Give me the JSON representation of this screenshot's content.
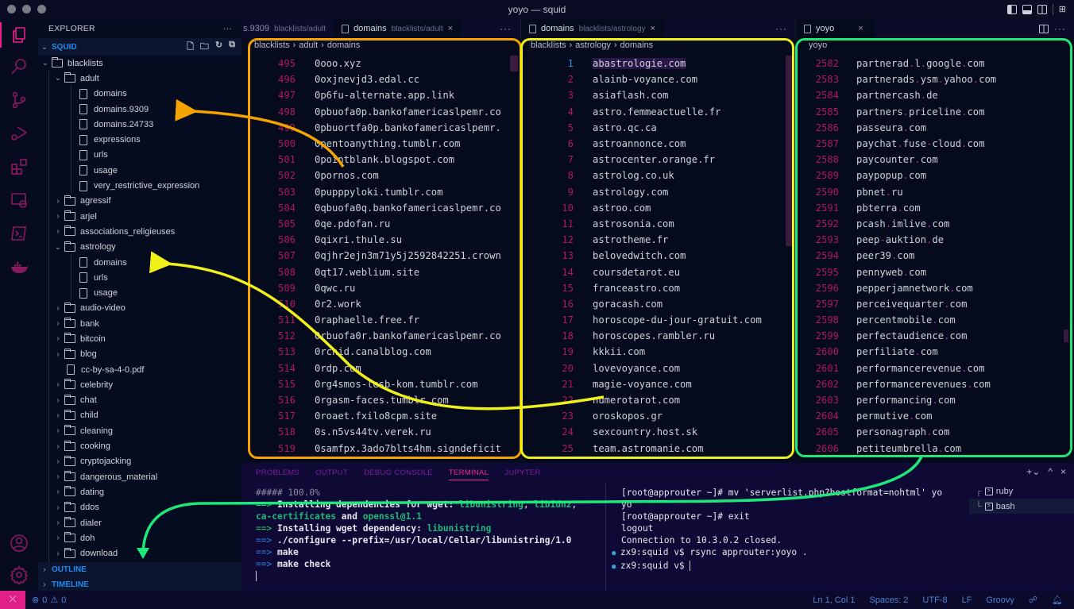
{
  "window": {
    "title": "yoyo — squid"
  },
  "activity_bar": {
    "items": [
      "explorer",
      "search",
      "source-control",
      "run-debug",
      "extensions",
      "remote-explorer",
      "terminal",
      "docker",
      "accounts",
      "settings"
    ]
  },
  "sidebar": {
    "header": "EXPLORER",
    "more": "···",
    "section": "SQUID",
    "tree": [
      {
        "label": "blacklists",
        "type": "folder",
        "depth": 0,
        "open": true
      },
      {
        "label": "adult",
        "type": "folder",
        "depth": 1,
        "open": true
      },
      {
        "label": "domains",
        "type": "file",
        "depth": 2
      },
      {
        "label": "domains.9309",
        "type": "file",
        "depth": 2
      },
      {
        "label": "domains.24733",
        "type": "file",
        "depth": 2
      },
      {
        "label": "expressions",
        "type": "file",
        "depth": 2
      },
      {
        "label": "urls",
        "type": "file",
        "depth": 2
      },
      {
        "label": "usage",
        "type": "file",
        "depth": 2
      },
      {
        "label": "very_restrictive_expression",
        "type": "file",
        "depth": 2
      },
      {
        "label": "agressif",
        "type": "folder",
        "depth": 1,
        "open": false
      },
      {
        "label": "arjel",
        "type": "folder",
        "depth": 1,
        "open": false
      },
      {
        "label": "associations_religieuses",
        "type": "folder",
        "depth": 1,
        "open": false
      },
      {
        "label": "astrology",
        "type": "folder",
        "depth": 1,
        "open": true
      },
      {
        "label": "domains",
        "type": "file",
        "depth": 2
      },
      {
        "label": "urls",
        "type": "file",
        "depth": 2
      },
      {
        "label": "usage",
        "type": "file",
        "depth": 2
      },
      {
        "label": "audio-video",
        "type": "folder",
        "depth": 1,
        "open": false
      },
      {
        "label": "bank",
        "type": "folder",
        "depth": 1,
        "open": false
      },
      {
        "label": "bitcoin",
        "type": "folder",
        "depth": 1,
        "open": false
      },
      {
        "label": "blog",
        "type": "folder",
        "depth": 1,
        "open": false
      },
      {
        "label": "cc-by-sa-4-0.pdf",
        "type": "file",
        "depth": 1
      },
      {
        "label": "celebrity",
        "type": "folder",
        "depth": 1,
        "open": false
      },
      {
        "label": "chat",
        "type": "folder",
        "depth": 1,
        "open": false
      },
      {
        "label": "child",
        "type": "folder",
        "depth": 1,
        "open": false
      },
      {
        "label": "cleaning",
        "type": "folder",
        "depth": 1,
        "open": false
      },
      {
        "label": "cooking",
        "type": "folder",
        "depth": 1,
        "open": false
      },
      {
        "label": "cryptojacking",
        "type": "folder",
        "depth": 1,
        "open": false
      },
      {
        "label": "dangerous_material",
        "type": "folder",
        "depth": 1,
        "open": false
      },
      {
        "label": "dating",
        "type": "folder",
        "depth": 1,
        "open": false
      },
      {
        "label": "ddos",
        "type": "folder",
        "depth": 1,
        "open": false
      },
      {
        "label": "dialer",
        "type": "folder",
        "depth": 1,
        "open": false
      },
      {
        "label": "doh",
        "type": "folder",
        "depth": 1,
        "open": false
      },
      {
        "label": "download",
        "type": "folder",
        "depth": 1,
        "open": false
      }
    ],
    "outline": "OUTLINE",
    "timeline": "TIMELINE"
  },
  "editors": [
    {
      "tabs": [
        {
          "name": "s.9309",
          "desc": "blacklists/adult",
          "active": false
        },
        {
          "name": "domains",
          "desc": "blacklists/adult",
          "active": true
        }
      ],
      "breadcrumb": [
        "blacklists",
        "adult",
        "domains"
      ],
      "start": 495,
      "lines": [
        "0ooo.xyz",
        "0oxjnevjd3.edal.cc",
        "0p6fu-alternate.app.link",
        "0pbuofa0p.bankofamericaslpemr.co",
        "0pbuortfa0p.bankofamericaslpemr.",
        "0pentoanything.tumblr.com",
        "0pointblank.blogspot.com",
        "0pornos.com",
        "0pupppyloki.tumblr.com",
        "0qbuofa0q.bankofamericaslpemr.co",
        "0qe.pdofan.ru",
        "0qixri.thule.su",
        "0qjhr2ejn3m71y5j2592842251.crown",
        "0qt17.weblium.site",
        "0qwc.ru",
        "0r2.work",
        "0raphaelle.free.fr",
        "0rbuofa0r.bankofamericaslpemr.co",
        "0rchid.canalblog.com",
        "0rdp.com",
        "0rg4smos-lesb-kom.tumblr.com",
        "0rgasm-faces.tumblr.com",
        "0roaet.fxilo8cpm.site",
        "0s.n5vs44tv.verek.ru",
        "0samfpx.3ado7blts4hm.signdeficit"
      ]
    },
    {
      "tabs": [
        {
          "name": "domains",
          "desc": "blacklists/astrology",
          "active": true
        }
      ],
      "breadcrumb": [
        "blacklists",
        "astrology",
        "domains"
      ],
      "start": 1,
      "current_line": 1,
      "lines": [
        "abastrologie.com",
        "alainb-voyance.com",
        "asiaflash.com",
        "astro.femmeactuelle.fr",
        "astro.qc.ca",
        "astroannonce.com",
        "astrocenter.orange.fr",
        "astrolog.co.uk",
        "astrology.com",
        "astroo.com",
        "astrosonia.com",
        "astrotheme.fr",
        "belovedwitch.com",
        "coursdetarot.eu",
        "franceastro.com",
        "goracash.com",
        "horoscope-du-jour-gratuit.com",
        "horoscopes.rambler.ru",
        "kkkii.com",
        "lovevoyance.com",
        "magie-voyance.com",
        "numerotarot.com",
        "oroskopos.gr",
        "sexcountry.host.sk",
        "team.astromanie.com"
      ]
    },
    {
      "tabs": [
        {
          "name": "yoyo",
          "desc": "",
          "active": true
        }
      ],
      "breadcrumb": [
        "yoyo"
      ],
      "start": 2582,
      "lines": [
        "partnerad.l.google.com",
        "partnerads.ysm.yahoo.com",
        "partnercash.de",
        "partners.priceline.com",
        "passeura.com",
        "paychat.fuse-cloud.com",
        "paycounter.com",
        "paypopup.com",
        "pbnet.ru",
        "pbterra.com",
        "pcash.imlive.com",
        "peep-auktion.de",
        "peer39.com",
        "pennyweb.com",
        "pepperjamnetwork.com",
        "perceivequarter.com",
        "percentmobile.com",
        "perfectaudience.com",
        "perfiliate.com",
        "performancerevenue.com",
        "performancerevenues.com",
        "performancing.com",
        "permutive.com",
        "personagraph.com",
        "petiteumbrella.com"
      ]
    }
  ],
  "panel": {
    "tabs": [
      "PROBLEMS",
      "OUTPUT",
      "DEBUG CONSOLE",
      "TERMINAL",
      "JUPYTER"
    ],
    "active_tab": "TERMINAL",
    "terminal_left": [
      "##### 100.0%",
      "==> Installing dependencies for wget: libunistring, libidn2,",
      "ca-certificates and openssl@1.1",
      "==> Installing wget dependency: libunistring",
      "==> ./configure --prefix=/usr/local/Cellar/libunistring/1.0",
      "==> make",
      "==> make check"
    ],
    "terminal_right": [
      "[root@approuter ~]# mv 'serverlist.php?hostformat=nohtml' yo",
      "yo",
      "[root@approuter ~]# exit",
      "logout",
      "Connection to 10.3.0.2 closed.",
      "zx9:squid v$ rsync approuter:yoyo .",
      "zx9:squid v$ "
    ],
    "terminals": [
      "ruby",
      "bash"
    ],
    "selected_terminal": "bash"
  },
  "status_bar": {
    "errors": "0",
    "warnings": "0",
    "position": "Ln 1, Col 1",
    "spaces": "Spaces: 2",
    "encoding": "UTF-8",
    "eol": "LF",
    "language": "Groovy"
  },
  "annotations": {
    "colors": {
      "adult": "#f5a300",
      "astrology": "#f0f01a",
      "yoyo": "#1ee87a"
    }
  }
}
